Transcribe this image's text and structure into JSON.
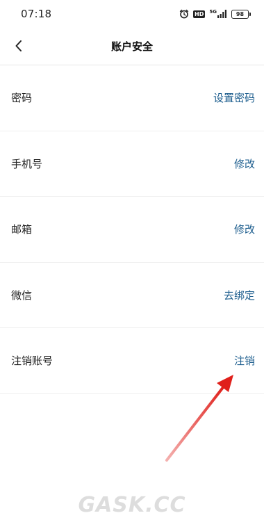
{
  "status_bar": {
    "time": "07:18",
    "hd_label": "HD",
    "network_label": "5G",
    "battery_level": "98"
  },
  "header": {
    "title": "账户安全",
    "back_icon": "chevron-left-icon"
  },
  "rows": [
    {
      "label": "密码",
      "action": "设置密码"
    },
    {
      "label": "手机号",
      "action": "修改"
    },
    {
      "label": "邮箱",
      "action": "修改"
    },
    {
      "label": "微信",
      "action": "去绑定"
    },
    {
      "label": "注销账号",
      "action": "注销"
    }
  ],
  "colors": {
    "action_text": "#1f5f8f",
    "annotation_arrow": "#e0201b",
    "divider": "#efefef"
  },
  "watermark": "GASK.CC"
}
